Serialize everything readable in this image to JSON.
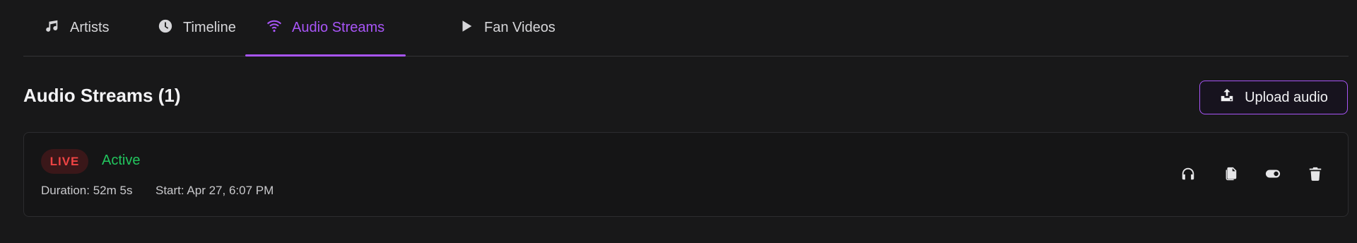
{
  "tabs": [
    {
      "label": "Artists",
      "icon": "music-note-icon",
      "active": false
    },
    {
      "label": "Timeline",
      "icon": "clock-icon",
      "active": false
    },
    {
      "label": "Audio Streams",
      "icon": "wifi-icon",
      "active": true
    },
    {
      "label": "Fan Videos",
      "icon": "play-icon",
      "active": false
    }
  ],
  "section": {
    "title": "Audio Streams (1)",
    "upload_label": "Upload audio"
  },
  "stream": {
    "badge": "LIVE",
    "status": "Active",
    "duration": "Duration: 52m 5s",
    "start": "Start: Apr 27, 6:07 PM",
    "actions": [
      "headphones-icon",
      "copy-icon",
      "toggle-icon",
      "trash-icon"
    ]
  },
  "colors": {
    "background": "#181819",
    "accent": "#a855f7",
    "live": "#ef4444",
    "active": "#22c55e"
  }
}
